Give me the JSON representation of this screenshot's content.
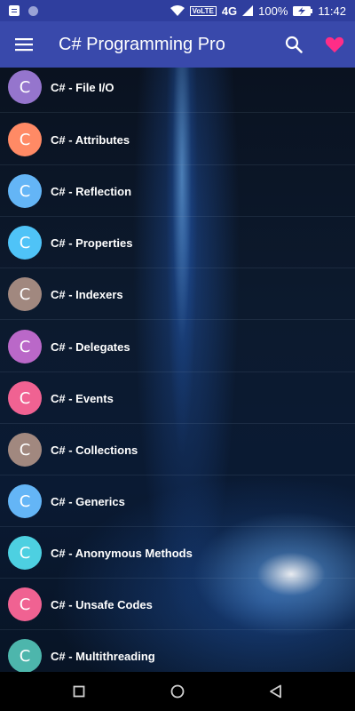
{
  "status_bar": {
    "volte": "VoLTE",
    "network": "4G",
    "battery": "100%",
    "time": "11:42"
  },
  "app_bar": {
    "title": "C# Programming Pro",
    "icons": [
      "menu-icon",
      "search-icon",
      "heart-icon"
    ]
  },
  "list": {
    "items": [
      {
        "letter": "C",
        "label": "C# - File I/O",
        "color": "#9575cd"
      },
      {
        "letter": "C",
        "label": "C# - Attributes",
        "color": "#ff8a65"
      },
      {
        "letter": "C",
        "label": "C# - Reflection",
        "color": "#64b5f6"
      },
      {
        "letter": "C",
        "label": "C# - Properties",
        "color": "#4fc3f7"
      },
      {
        "letter": "C",
        "label": "C# - Indexers",
        "color": "#a1887f"
      },
      {
        "letter": "C",
        "label": "C# - Delegates",
        "color": "#ba68c8"
      },
      {
        "letter": "C",
        "label": "C# - Events",
        "color": "#f06292"
      },
      {
        "letter": "C",
        "label": "C# - Collections",
        "color": "#a1887f"
      },
      {
        "letter": "C",
        "label": "C# - Generics",
        "color": "#64b5f6"
      },
      {
        "letter": "C",
        "label": "C# - Anonymous Methods",
        "color": "#4dd0e1"
      },
      {
        "letter": "C",
        "label": "C# - Unsafe Codes",
        "color": "#f06292"
      },
      {
        "letter": "C",
        "label": "C# - Multithreading",
        "color": "#4db6ac"
      }
    ]
  },
  "nav_bar": {
    "icons": [
      "recents-icon",
      "home-icon",
      "back-icon"
    ]
  }
}
